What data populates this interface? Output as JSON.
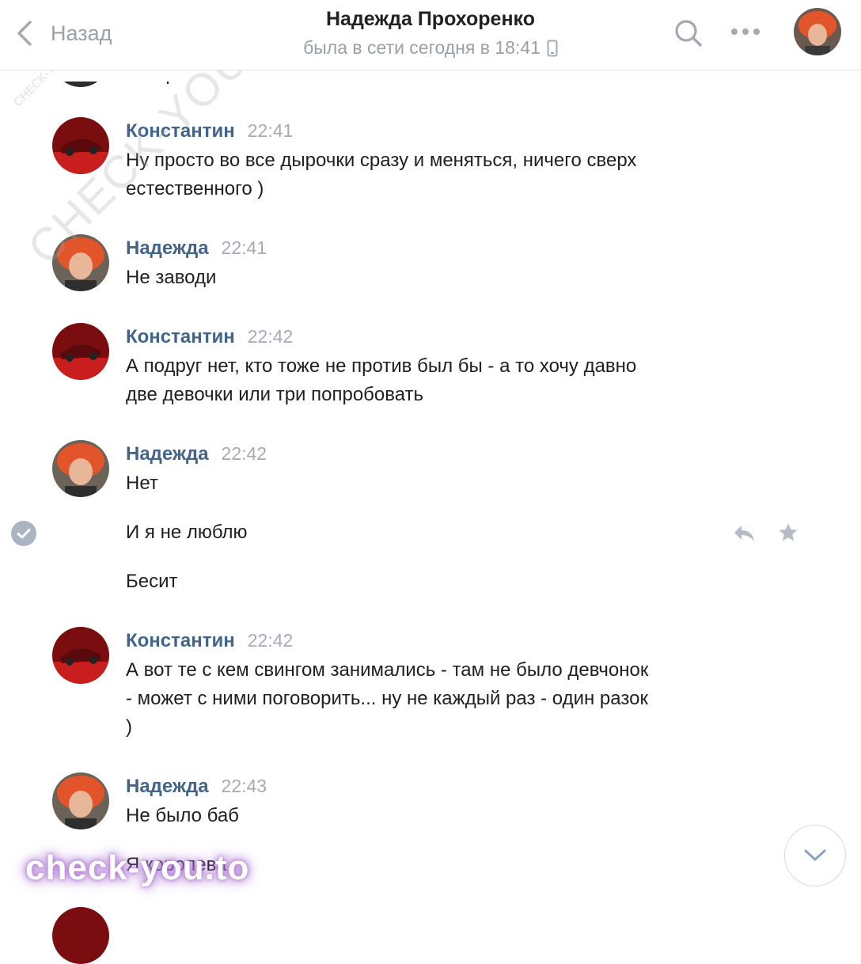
{
  "header": {
    "back_label": "Назад",
    "contact_name": "Надежда Прохоренко",
    "status": "была в сети сегодня в 18:41"
  },
  "partial_top_text": "Не пробовала",
  "messages": [
    {
      "author": "Константин",
      "time": "22:41",
      "lines": [
        "Ну просто во все дырочки сразу и меняться, ничего сверх",
        "естественного )"
      ]
    },
    {
      "author": "Надежда",
      "time": "22:41",
      "lines": [
        "Не заводи"
      ]
    },
    {
      "author": "Константин",
      "time": "22:42",
      "lines": [
        "А подруг нет, кто тоже не против был бы - а то хочу давно",
        "две девочки или три попробовать"
      ]
    },
    {
      "author": "Надежда",
      "time": "22:42",
      "lines": [
        "Нет"
      ]
    },
    {
      "text": "И я не люблю"
    },
    {
      "text": "Бесит"
    },
    {
      "author": "Константин",
      "time": "22:42",
      "lines": [
        "А вот те с кем свингом занимались - там не было девчонок",
        "- может с ними поговорить... ну не каждый раз - один разок",
        ")"
      ]
    },
    {
      "author": "Надежда",
      "time": "22:43",
      "lines": [
        "Не было баб"
      ]
    },
    {
      "text": "Я королева"
    }
  ],
  "watermarks": {
    "diagonal": "CHECK-YOU.ME",
    "small": "CHECK-YOU.ME",
    "bottom": "check-you.to"
  },
  "colors": {
    "author": "#42648b",
    "muted": "#9aa0a8",
    "check_badge": "#aab4c3"
  }
}
